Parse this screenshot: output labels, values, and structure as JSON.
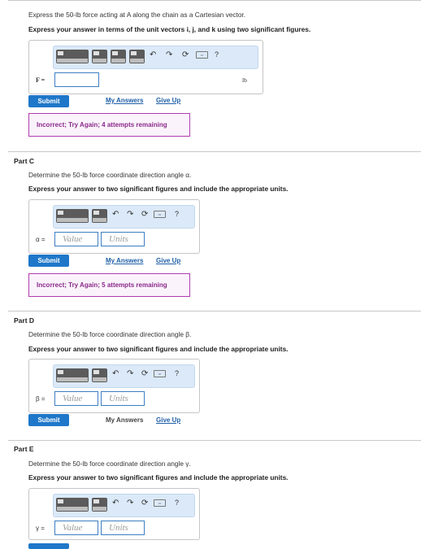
{
  "partB": {
    "question": "Express the 50-lb force acting at A along the chain as a Cartesian vector.",
    "instruction": "Express your answer in terms of the unit vectors i, j, and k using two significant figures.",
    "var_label": "F =",
    "unit": "lb",
    "submit": "Submit",
    "my_answers": "My Answers",
    "give_up": "Give Up",
    "feedback": "Incorrect; Try Again; 4 attempts remaining"
  },
  "partC": {
    "title": "Part C",
    "question": "Determine the 50-lb force coordinate direction angle α.",
    "instruction": "Express your answer to two significant figures and include the appropriate units.",
    "var_label": "α =",
    "value_placeholder": "Value",
    "units_placeholder": "Units",
    "submit": "Submit",
    "my_answers": "My Answers",
    "give_up": "Give Up",
    "feedback": "Incorrect; Try Again; 5 attempts remaining"
  },
  "partD": {
    "title": "Part D",
    "question": "Determine the 50-lb force coordinate direction angle β.",
    "instruction": "Express your answer to two significant figures and include the appropriate units.",
    "var_label": "β =",
    "value_placeholder": "Value",
    "units_placeholder": "Units",
    "submit": "Submit",
    "my_answers": "My Answers",
    "give_up": "Give Up"
  },
  "partE": {
    "title": "Part E",
    "question": "Determine the 50-lb force coordinate direction angle γ.",
    "instruction": "Express your answer to two significant figures and include the appropriate units.",
    "var_label": "γ =",
    "value_placeholder": "Value",
    "units_placeholder": "Units"
  },
  "toolbar": {
    "undo": "↶",
    "redo": "↷",
    "reset": "⟳",
    "help": "?"
  }
}
